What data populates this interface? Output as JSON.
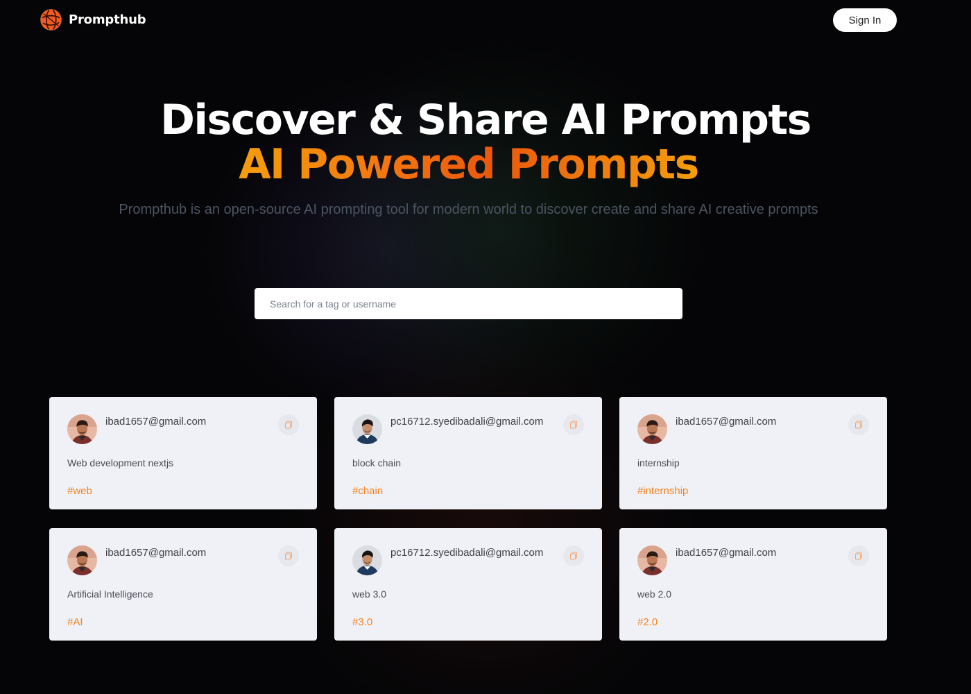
{
  "brand": {
    "name": "Prompthub",
    "logo_icon": "globe-icon",
    "accent": "#ea580c"
  },
  "nav": {
    "signin_label": "Sign In"
  },
  "hero": {
    "headline": "Discover & Share AI Prompts",
    "highlight": "AI Powered Prompts",
    "description": "Prompthub is an open-source AI prompting tool for modern world to discover create and share AI creative prompts"
  },
  "search": {
    "placeholder": "Search for a tag or username",
    "value": ""
  },
  "colors": {
    "tag": "#f2821c",
    "card_bg": "#eff1f6",
    "gradient_start": "#f59e0b",
    "gradient_mid": "#ea580c"
  },
  "prompts": [
    {
      "email": "ibad1657@gmail.com",
      "avatar": "avatar-ibad",
      "prompt": "Web development nextjs",
      "tag": "#web",
      "copy_icon": "copy-icon"
    },
    {
      "email": "pc16712.syedibadali@gmail.com",
      "avatar": "avatar-syed",
      "prompt": "block chain",
      "tag": "#chain",
      "copy_icon": "copy-icon"
    },
    {
      "email": "ibad1657@gmail.com",
      "avatar": "avatar-ibad",
      "prompt": "internship",
      "tag": "#internship",
      "copy_icon": "copy-icon"
    },
    {
      "email": "ibad1657@gmail.com",
      "avatar": "avatar-ibad",
      "prompt": "Artificial Intelligence",
      "tag": "#AI",
      "copy_icon": "copy-icon"
    },
    {
      "email": "pc16712.syedibadali@gmail.com",
      "avatar": "avatar-syed",
      "prompt": "web 3.0",
      "tag": "#3.0",
      "copy_icon": "copy-icon"
    },
    {
      "email": "ibad1657@gmail.com",
      "avatar": "avatar-ibad",
      "prompt": "web 2.0",
      "tag": "#2.0",
      "copy_icon": "copy-icon"
    }
  ]
}
